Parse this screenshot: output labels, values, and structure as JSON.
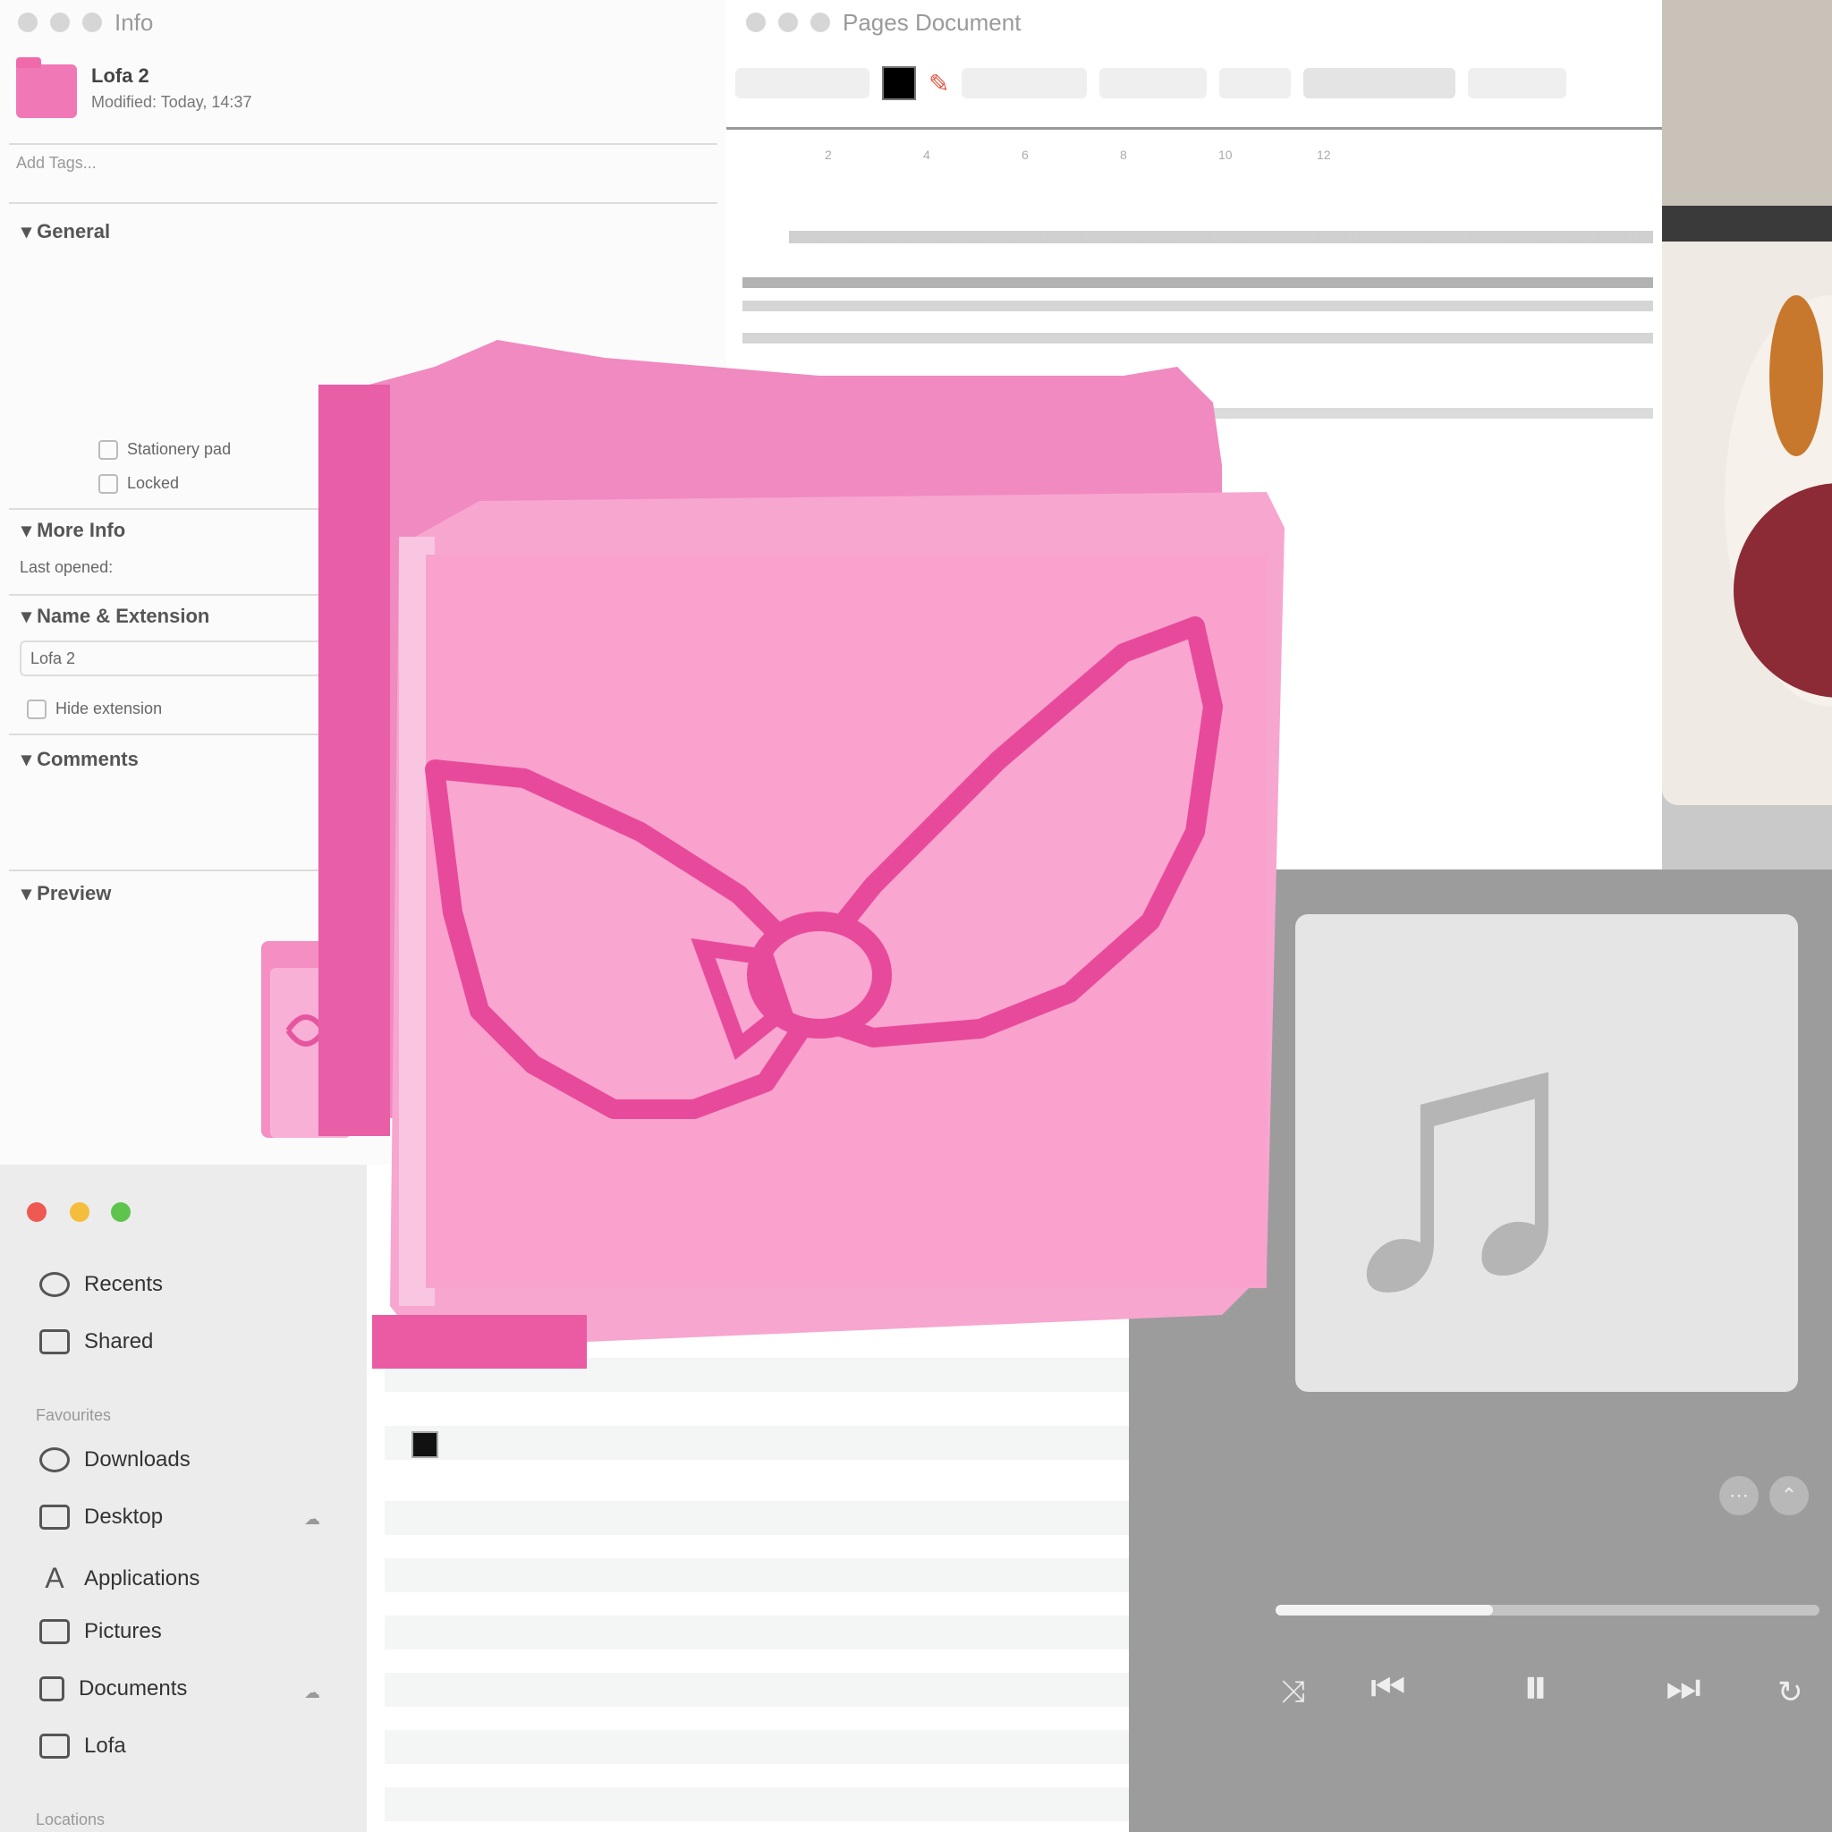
{
  "info_window": {
    "title": "Info",
    "name": "Lofa 2",
    "modified": "Modified: Today, 14:37",
    "size": "",
    "tags_placeholder": "Add Tags...",
    "sections": {
      "general": "General",
      "more_info": "More Info",
      "name_extension": "Name & Extension",
      "comments": "Comments",
      "preview": "Preview"
    },
    "general_rows": [],
    "stationery_label": "Stationery pad",
    "locked_label": "Locked",
    "last_opened": "Last opened:",
    "name_value": "Lofa 2",
    "hide_extension": "Hide extension"
  },
  "doc_window": {
    "title": "Pages Document",
    "font_size": "",
    "style_label": "",
    "page_label": ""
  },
  "finder_window": {
    "sidebar": {
      "items": [
        {
          "icon": "clock-icon",
          "label": "Recents"
        },
        {
          "icon": "shared-icon",
          "label": "Shared"
        }
      ],
      "favourites_header": "Favourites",
      "favourites": [
        {
          "icon": "downloads-icon",
          "label": "Downloads"
        },
        {
          "icon": "desktop-icon",
          "label": "Desktop"
        },
        {
          "icon": "applications-icon",
          "label": "Applications"
        },
        {
          "icon": "folder-icon",
          "label": "Pictures"
        },
        {
          "icon": "document-icon",
          "label": "Documents"
        },
        {
          "icon": "folder-icon",
          "label": "Lofa"
        }
      ],
      "locations_header": "Locations"
    },
    "rows": [
      {
        "name": "",
        "date": ""
      },
      {
        "name": "",
        "date": ""
      },
      {
        "name": "",
        "date": ""
      },
      {
        "name": "",
        "date": ""
      }
    ]
  },
  "music_player": {
    "track": "",
    "elapsed": "",
    "remaining": "",
    "progress": 0.4
  },
  "colors": {
    "folder_pink": "#f48cc4",
    "folder_dark": "#e94f9b",
    "folder_light": "#f9b3d8",
    "selection_blue": "#2f56b8"
  }
}
